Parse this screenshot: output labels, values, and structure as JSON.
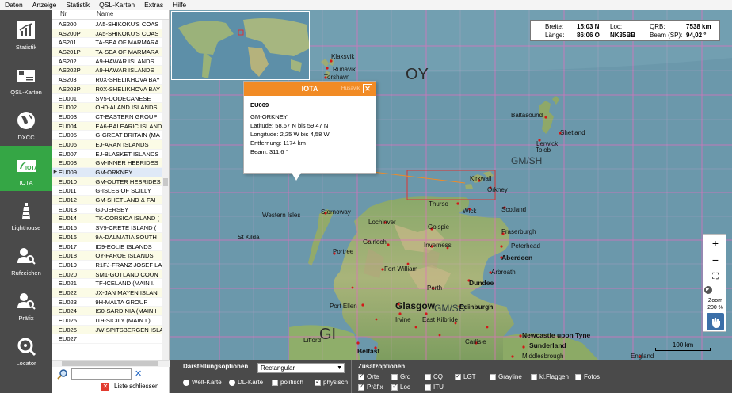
{
  "menu": [
    "Daten",
    "Anzeige",
    "Statistik",
    "QSL-Karten",
    "Extras",
    "Hilfe"
  ],
  "toolbar": [
    {
      "label": "Statistik",
      "icon": "chart-icon"
    },
    {
      "label": "QSL-Karten",
      "icon": "qsl-card-icon"
    },
    {
      "label": "DXCC",
      "icon": "globe-icon"
    },
    {
      "label": "IOTA",
      "icon": "iota-icon",
      "active": true
    },
    {
      "label": "Lighthouse",
      "icon": "lighthouse-icon"
    },
    {
      "label": "Rufzeichen",
      "icon": "callsign-search-icon"
    },
    {
      "label": "Präfix",
      "icon": "prefix-search-icon"
    },
    {
      "label": "Locator",
      "icon": "locator-icon"
    }
  ],
  "list": {
    "col_nr": "Nr",
    "col_name": "Name",
    "rows": [
      {
        "nr": "AS200",
        "name": "JA5-SHIKOKU'S COAS"
      },
      {
        "nr": "AS200P",
        "name": "JA5-SHIKOKU'S COAS"
      },
      {
        "nr": "AS201",
        "name": "TA-SEA OF MARMARA"
      },
      {
        "nr": "AS201P",
        "name": "TA-SEA OF MARMARA"
      },
      {
        "nr": "AS202",
        "name": "A9-HAWAR ISLANDS"
      },
      {
        "nr": "AS202P",
        "name": "A9-HAWAR ISLANDS"
      },
      {
        "nr": "AS203",
        "name": "R0X-SHELIKHOVA BAY"
      },
      {
        "nr": "AS203P",
        "name": "R0X-SHELIKHOVA BAY"
      },
      {
        "nr": "EU001",
        "name": "SV5-DODECANESE"
      },
      {
        "nr": "EU002",
        "name": "OH0-ALAND ISLANDS"
      },
      {
        "nr": "EU003",
        "name": "CT-EASTERN GROUP"
      },
      {
        "nr": "EU004",
        "name": "EA6-BALEARIC ISLAND"
      },
      {
        "nr": "EU005",
        "name": "G-GREAT BRITAIN (MA"
      },
      {
        "nr": "EU006",
        "name": "EJ-ARAN ISLANDS"
      },
      {
        "nr": "EU007",
        "name": "EJ-BLASKET ISLANDS"
      },
      {
        "nr": "EU008",
        "name": "GM-INNER HEBRIDES"
      },
      {
        "nr": "EU009",
        "name": "GM-ORKNEY",
        "selected": true
      },
      {
        "nr": "EU010",
        "name": "GM-OUTER HEBRIDES"
      },
      {
        "nr": "EU011",
        "name": "G-ISLES OF SCILLY"
      },
      {
        "nr": "EU012",
        "name": "GM-SHETLAND & FAI"
      },
      {
        "nr": "EU013",
        "name": "GJ-JERSEY"
      },
      {
        "nr": "EU014",
        "name": "TK-CORSICA ISLAND ("
      },
      {
        "nr": "EU015",
        "name": "SV9-CRETE ISLAND ("
      },
      {
        "nr": "EU016",
        "name": "9A-DALMATIA SOUTH"
      },
      {
        "nr": "EU017",
        "name": "ID9-EOLIE ISLANDS"
      },
      {
        "nr": "EU018",
        "name": "OY-FAROE ISLANDS"
      },
      {
        "nr": "EU019",
        "name": "R1FJ-FRANZ JOSEF LA"
      },
      {
        "nr": "EU020",
        "name": "SM1-GOTLAND COUN"
      },
      {
        "nr": "EU021",
        "name": "TF-ICELAND (MAIN I."
      },
      {
        "nr": "EU022",
        "name": "JX-JAN MAYEN ISLAN"
      },
      {
        "nr": "EU023",
        "name": "9H-MALTA GROUP"
      },
      {
        "nr": "EU024",
        "name": "IS0-SARDINIA (MAIN I"
      },
      {
        "nr": "EU025",
        "name": "IT9-SICILY (MAIN I.)"
      },
      {
        "nr": "EU026",
        "name": "JW-SPITSBERGEN ISLA"
      },
      {
        "nr": "EU027",
        "name": ""
      }
    ],
    "search_value": "",
    "close_label": "Liste schliessen"
  },
  "coords": {
    "breite_label": "Breite:",
    "breite": "15:03 N",
    "laenge_label": "Länge:",
    "laenge": "86:06 O",
    "loc_label": "Loc:",
    "loc": "NK35BB",
    "qrb_label": "QRB:",
    "qrb": "7538 km",
    "beam_label": "Beam (SP):",
    "beam": "94,02 °"
  },
  "popup": {
    "title": "IOTA",
    "ref": "EU009",
    "name": "GM-ORKNEY",
    "latitude": "Latitude:  58,67 N bis  59,47 N",
    "longitude": "Longitude:  2,25 W bis  4,58 W",
    "distance": "Entfernung: 1174 km",
    "beam": "Beam: 311,6 °",
    "behind_label": "Husavik"
  },
  "map_labels": [
    {
      "t": "Klaksvik",
      "k": ""
    },
    {
      "t": "Runavik",
      "k": ""
    },
    {
      "t": "Torshavn",
      "k": ""
    },
    {
      "t": "OY",
      "k": "big"
    },
    {
      "t": "Baltasound",
      "k": ""
    },
    {
      "t": "Shetland",
      "k": ""
    },
    {
      "t": "Lerwick",
      "k": ""
    },
    {
      "t": "Tolob",
      "k": ""
    },
    {
      "t": "GM/SH",
      "k": "mid"
    },
    {
      "t": "Kirkwall",
      "k": ""
    },
    {
      "t": "Orkney",
      "k": ""
    },
    {
      "t": "Thurso",
      "k": ""
    },
    {
      "t": "Wick",
      "k": ""
    },
    {
      "t": "Scotland",
      "k": ""
    },
    {
      "t": "Western Isles",
      "k": ""
    },
    {
      "t": "Stornoway",
      "k": ""
    },
    {
      "t": "Lochinver",
      "k": ""
    },
    {
      "t": "Golspie",
      "k": ""
    },
    {
      "t": "Fraserburgh",
      "k": ""
    },
    {
      "t": "St Kilda",
      "k": ""
    },
    {
      "t": "Gairloch",
      "k": ""
    },
    {
      "t": "Peterhead",
      "k": ""
    },
    {
      "t": "Portree",
      "k": ""
    },
    {
      "t": "Inverness",
      "k": ""
    },
    {
      "t": "Aberdeen",
      "k": "bold"
    },
    {
      "t": "Fort William",
      "k": ""
    },
    {
      "t": "Arbroath",
      "k": ""
    },
    {
      "t": "Perth",
      "k": ""
    },
    {
      "t": "Dundee",
      "k": "bold"
    },
    {
      "t": "Port Ellen",
      "k": ""
    },
    {
      "t": "Glasgow",
      "k": "huge"
    },
    {
      "t": "GM/SC",
      "k": "mid"
    },
    {
      "t": "Edinburgh",
      "k": "bold"
    },
    {
      "t": "Irvine",
      "k": ""
    },
    {
      "t": "East Kilbride",
      "k": ""
    },
    {
      "t": "GI",
      "k": "big"
    },
    {
      "t": "Lifford",
      "k": ""
    },
    {
      "t": "Belfast",
      "k": "bold"
    },
    {
      "t": "Carlisle",
      "k": ""
    },
    {
      "t": "Newcastle upon Tyne",
      "k": "bold"
    },
    {
      "t": "Sunderland",
      "k": "bold"
    },
    {
      "t": "Middlesbrough",
      "k": ""
    },
    {
      "t": "England",
      "k": ""
    }
  ],
  "zoom": {
    "label": "Zoom",
    "level": "200 %"
  },
  "scale": "100 km",
  "bottom": {
    "display_title": "Darstellungsoptionen",
    "projection": "Rectangular",
    "radios": [
      {
        "label": "Welt-Karte",
        "on": false
      },
      {
        "label": "DL-Karte",
        "on": false
      }
    ],
    "map_checks": [
      {
        "label": "politisch",
        "on": false
      },
      {
        "label": "physisch",
        "on": true
      }
    ],
    "extra_title": "Zusatzoptionen",
    "extras": [
      {
        "label": "Orte",
        "on": true
      },
      {
        "label": "Grd",
        "on": false
      },
      {
        "label": "CQ",
        "on": false
      },
      {
        "label": "LGT",
        "on": true
      },
      {
        "label": "Grayline",
        "on": false
      },
      {
        "label": "kl.Flaggen",
        "on": false
      },
      {
        "label": "Fotos",
        "on": false
      },
      {
        "label": "Präfix",
        "on": true
      },
      {
        "label": "Loc",
        "on": true
      },
      {
        "label": "ITU",
        "on": false
      }
    ]
  },
  "colors": {
    "accent": "#35a645",
    "popup": "#f18b25",
    "grid": "#e06fbf",
    "toolbar": "#4a4a4a"
  }
}
